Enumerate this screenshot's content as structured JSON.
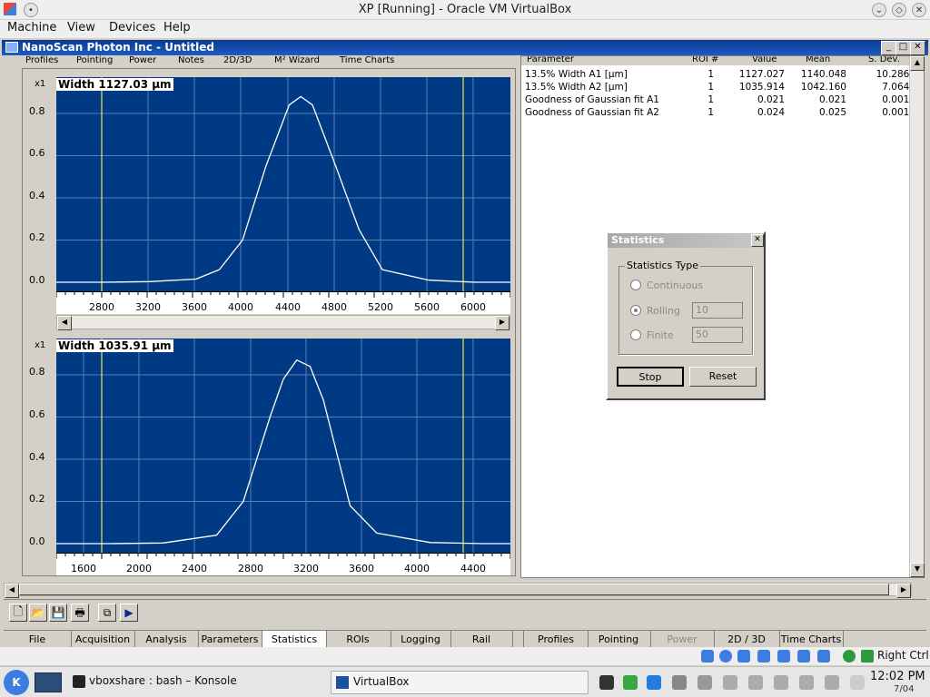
{
  "host": {
    "title": "XP [Running] - Oracle VM VirtualBox",
    "menu": [
      "Machine",
      "View",
      "Devices",
      "Help"
    ]
  },
  "app": {
    "title": "NanoScan Photon Inc - Untitled",
    "top_tabs": [
      "Profiles",
      "Pointing",
      "Power",
      "Notes",
      "2D/3D",
      "M² Wizard",
      "Time Charts"
    ]
  },
  "plots": [
    {
      "width_label": "Width 1127.03 µm",
      "zoom_label": "x1",
      "y_ticks": [
        "0.8",
        "0.6",
        "0.4",
        "0.2",
        "0.0"
      ],
      "x_ticks": [
        "2800",
        "3200",
        "3600",
        "4000",
        "4400",
        "4800",
        "5200",
        "5600",
        "6000"
      ]
    },
    {
      "width_label": "Width 1035.91 µm",
      "zoom_label": "x1",
      "y_ticks": [
        "0.8",
        "0.6",
        "0.4",
        "0.2",
        "0.0"
      ],
      "x_ticks": [
        "1600",
        "2000",
        "2400",
        "2800",
        "3200",
        "3600",
        "4000",
        "4400"
      ]
    }
  ],
  "chart_data": [
    {
      "type": "line",
      "x": [
        2400,
        2800,
        3200,
        3600,
        3800,
        4000,
        4200,
        4400,
        4500,
        4600,
        4800,
        5000,
        5200,
        5600,
        6000,
        6300
      ],
      "values": [
        0,
        0,
        0.003,
        0.015,
        0.06,
        0.2,
        0.55,
        0.84,
        0.88,
        0.84,
        0.55,
        0.25,
        0.06,
        0.01,
        0,
        0
      ],
      "xlim": [
        2400,
        6300
      ],
      "ylim": [
        0,
        1
      ]
    },
    {
      "type": "line",
      "x": [
        1200,
        1600,
        2000,
        2400,
        2600,
        2800,
        2900,
        3000,
        3100,
        3200,
        3400,
        3600,
        4000,
        4400,
        4600
      ],
      "values": [
        0,
        0,
        0.003,
        0.04,
        0.2,
        0.6,
        0.78,
        0.87,
        0.84,
        0.68,
        0.18,
        0.05,
        0.005,
        0,
        0
      ],
      "xlim": [
        1200,
        4600
      ],
      "ylim": [
        0,
        1
      ]
    }
  ],
  "stats_table": {
    "headers": [
      "Parameter",
      "ROI #",
      "Value",
      "Mean",
      "S. Dev."
    ],
    "rows": [
      [
        "13.5% Width A1 [µm]",
        "1",
        "1127.027",
        "1140.048",
        "10.2860"
      ],
      [
        "13.5% Width A2 [µm]",
        "1",
        "1035.914",
        "1042.160",
        "7.0642"
      ],
      [
        "Goodness of Gaussian fit A1",
        "1",
        "0.021",
        "0.021",
        "0.0012"
      ],
      [
        "Goodness of Gaussian fit A2",
        "1",
        "0.024",
        "0.025",
        "0.0013"
      ]
    ]
  },
  "dialog": {
    "title": "Statistics",
    "group": "Statistics Type",
    "options": [
      {
        "label": "Continuous",
        "value": ""
      },
      {
        "label": "Rolling",
        "value": "10"
      },
      {
        "label": "Finite",
        "value": "50"
      }
    ],
    "stop": "Stop",
    "reset": "Reset"
  },
  "bottom_tabs_left": [
    "File",
    "Acquisition",
    "Analysis",
    "Parameters",
    "Statistics",
    "ROIs",
    "Logging",
    "Rail"
  ],
  "bottom_tabs_right": [
    "Profiles",
    "Pointing",
    "Power",
    "2D / 3D",
    "Time Charts"
  ],
  "statusbar": {
    "right_ctrl": "Right Ctrl"
  },
  "taskbar": {
    "konsole": "vboxshare : bash – Konsole",
    "virtualbox": "VirtualBox",
    "time": "12:02 PM",
    "date": "7/04"
  },
  "colors": {
    "plot_bg": "#003a84",
    "curve": "#ffffff",
    "cursor": "#e8e84c",
    "title_bar": "#0b3b8e"
  }
}
